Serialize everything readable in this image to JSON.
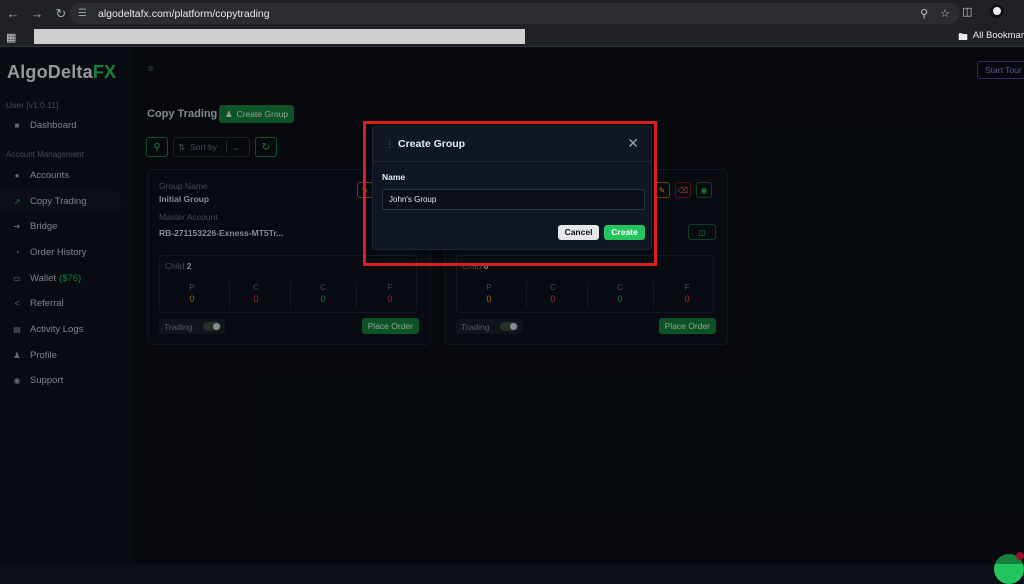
{
  "browser": {
    "url": "algodeltafx.com/platform/copytrading",
    "all_bookmarks_label": "All Bookmar"
  },
  "app": {
    "logo_main": "AlgoDelta",
    "logo_accent": "FX",
    "version": "User [v1.0.11]",
    "start_tour_label": "Start Tour"
  },
  "sidebar": {
    "account_management_label": "Account Management",
    "items": [
      {
        "label": "Dashboard",
        "icon": "dashboard-icon"
      },
      {
        "label": "Accounts",
        "icon": "users-icon"
      },
      {
        "label": "Copy Trading",
        "icon": "trend-icon"
      },
      {
        "label": "Bridge",
        "icon": "bridge-icon"
      },
      {
        "label": "Order History",
        "icon": "history-icon"
      },
      {
        "label": "Wallet",
        "icon": "wallet-icon",
        "amount": "($76)"
      },
      {
        "label": "Referral",
        "icon": "share-icon"
      },
      {
        "label": "Activity Logs",
        "icon": "logs-icon"
      },
      {
        "label": "Profile",
        "icon": "profile-icon"
      },
      {
        "label": "Support",
        "icon": "support-icon"
      }
    ]
  },
  "main": {
    "title": "Copy Trading",
    "create_group_label": "Create Group",
    "sort_placeholder": "Sort by"
  },
  "cards": [
    {
      "group_name_label": "Group Name",
      "group_name": "Initial Group",
      "master_label": "Master Account",
      "master_account": "RB-271153226-Exness-MT5Tr...",
      "child_label": "Child",
      "child_count": "2",
      "stats": [
        {
          "key": "P",
          "value": "0",
          "color": "#f59e0b"
        },
        {
          "key": "C",
          "value": "0",
          "color": "#ef4444"
        },
        {
          "key": "C",
          "value": "0",
          "color": "#22c55e"
        },
        {
          "key": "F",
          "value": "0",
          "color": "#ef4444"
        }
      ],
      "trading_label": "Trading",
      "place_order_label": "Place Order"
    },
    {
      "child_label": "Child",
      "child_count": "0",
      "stats": [
        {
          "key": "P",
          "value": "0",
          "color": "#f59e0b"
        },
        {
          "key": "C",
          "value": "0",
          "color": "#ef4444"
        },
        {
          "key": "C",
          "value": "0",
          "color": "#22c55e"
        },
        {
          "key": "F",
          "value": "0",
          "color": "#ef4444"
        }
      ],
      "trading_label": "Trading",
      "place_order_label": "Place Order"
    }
  ],
  "modal": {
    "title": "Create Group",
    "name_label": "Name",
    "name_value": "John's Group",
    "cancel_label": "Cancel",
    "create_label": "Create"
  },
  "colors": {
    "accent_green": "#22c55e",
    "highlight_red": "#d82020"
  }
}
